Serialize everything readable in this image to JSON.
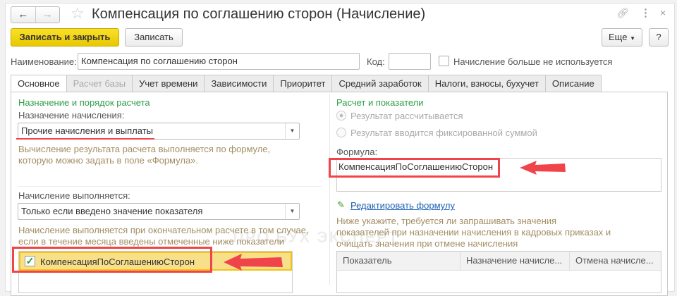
{
  "window": {
    "title": "Компенсация по соглашению сторон (Начисление)"
  },
  "toolbar": {
    "save_close": "Записать и закрыть",
    "save": "Записать",
    "more": "Еще",
    "help": "?"
  },
  "header": {
    "name_label": "Наименование:",
    "name_value": "Компенсация по соглашению сторон",
    "code_label": "Код:",
    "code_value": "",
    "not_used_label": "Начисление больше не используется",
    "not_used_checked": false
  },
  "tabs": [
    {
      "label": "Основное",
      "state": "active"
    },
    {
      "label": "Расчет базы",
      "state": "disabled"
    },
    {
      "label": "Учет времени"
    },
    {
      "label": "Зависимости"
    },
    {
      "label": "Приоритет"
    },
    {
      "label": "Средний заработок"
    },
    {
      "label": "Налоги, взносы, бухучет"
    },
    {
      "label": "Описание"
    }
  ],
  "left": {
    "section_title": "Назначение и порядок расчета",
    "purpose_label": "Назначение начисления:",
    "purpose_value": "Прочие начисления и выплаты",
    "purpose_hint1": "Вычисление результата расчета выполняется по формуле,",
    "purpose_hint2": "которую можно задать в поле «Формула».",
    "exec_label": "Начисление выполняется:",
    "exec_value": "Только если введено значение показателя",
    "exec_hint1": "Начисление выполняется при окончательном расчете в том случае,",
    "exec_hint2": "если в течение месяца введены отмеченные ниже показатели",
    "indicators": [
      {
        "name": "КомпенсацияПоСоглашениюСторон",
        "checked": true
      }
    ]
  },
  "right": {
    "section_title": "Расчет и показатели",
    "radio1": "Результат рассчитывается",
    "radio2": "Результат вводится фиксированной суммой",
    "formula_label": "Формула:",
    "formula_value": "КомпенсацияПоСоглашениюСторон",
    "edit_link": "Редактировать формулу",
    "hint1": "Ниже укажите, требуется ли запрашивать значения",
    "hint2": "показателей при назначении начисления в кадровых приказах и",
    "hint3": "очищать значения при отмене начисления",
    "table_headers": [
      "Показатель",
      "Назначение начисле...",
      "Отмена начисле..."
    ]
  },
  "watermark": "ПРО БУХ ЭКСПЕРТ",
  "colors": {
    "accent_yellow": "#f2d51a",
    "annotation_red": "#f0444a",
    "section_green": "#2e9e4a"
  }
}
